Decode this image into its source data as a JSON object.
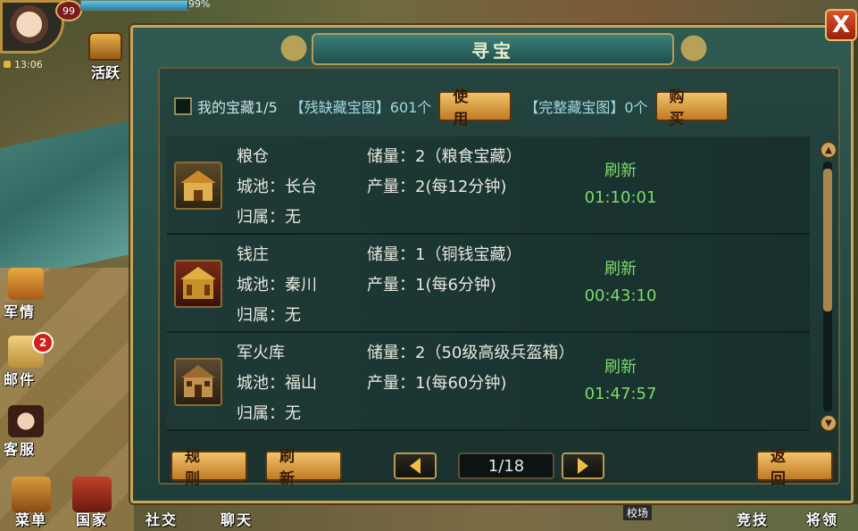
{
  "hud": {
    "level": "99",
    "exp_percent": 0.99,
    "exp_text": "99%",
    "clock": "13:06",
    "activity_label": "活跃"
  },
  "side_menu": [
    {
      "label": "军情"
    },
    {
      "label": "邮件",
      "badge": "2"
    },
    {
      "label": "客服"
    }
  ],
  "bottom_menu": [
    {
      "label": "菜单"
    },
    {
      "label": "国家"
    },
    {
      "label": "社交"
    },
    {
      "label": "聊天"
    },
    {
      "label": "竞技"
    },
    {
      "label": "将领"
    }
  ],
  "map_label": "校场",
  "dialog": {
    "title": "寻宝",
    "my_treasure": "我的宝藏1/5",
    "incomplete_map_label": "【残缺藏宝图】601个",
    "use_button": "使 用",
    "complete_map_label": "【完整藏宝图】0个",
    "buy_button": "购 买",
    "rows": [
      {
        "name": "粮仓",
        "city": "城池：长台",
        "owner": "归属：无",
        "storage": "储量：2（粮食宝藏）",
        "output": "产量：2(每12分钟)",
        "refresh_label": "刷新",
        "countdown": "01:10:01",
        "icon": "granary-icon"
      },
      {
        "name": "钱庄",
        "city": "城池：秦川",
        "owner": "归属：无",
        "storage": "储量：1（铜钱宝藏）",
        "output": "产量：1(每6分钟)",
        "refresh_label": "刷新",
        "countdown": "00:43:10",
        "icon": "bank-icon"
      },
      {
        "name": "军火库",
        "city": "城池：福山",
        "owner": "归属：无",
        "storage": "储量：2（50级高级兵盔箱）",
        "output": "产量：1(每60分钟)",
        "refresh_label": "刷新",
        "countdown": "01:47:57",
        "icon": "armory-icon"
      }
    ],
    "rules_button": "规 则",
    "refresh_button": "刷 新",
    "page": "1/18",
    "back_button": "返 回"
  },
  "close_label": "X"
}
